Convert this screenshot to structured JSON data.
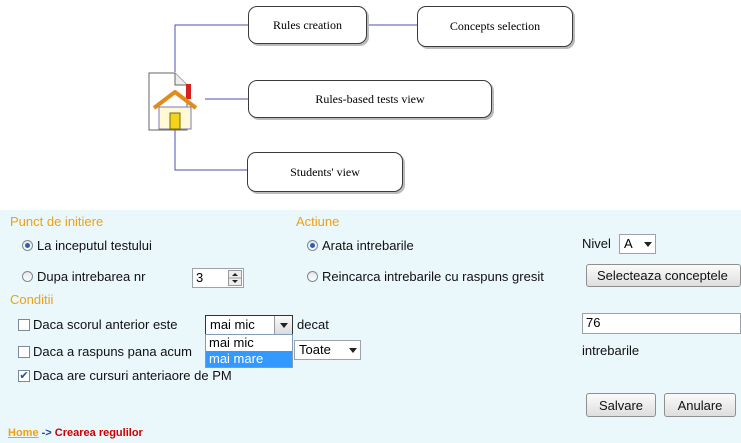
{
  "diagram": {
    "nodes": {
      "rules_creation": "Rules creation",
      "concepts_selection": "Concepts selection",
      "rules_tests_view": "Rules-based tests view",
      "students_view": "Students' view"
    },
    "icons": {
      "home": "home-document-icon"
    }
  },
  "form": {
    "punct_title": "Punct de initiere",
    "actiune_title": "Actiune",
    "conditii_title": "Conditii",
    "start_label": "La inceputul testului",
    "after_label": "Dupa intrebarea nr",
    "after_value": "3",
    "show_label": "Arata intrebarile",
    "reload_label": "Reincarca intrebarile cu raspuns gresit",
    "nivel_label": "Nivel",
    "nivel_value": "A",
    "select_concepts": "Selecteaza conceptele",
    "cond1_label": "Daca scorul anterior este",
    "cond1_select": "mai mic",
    "cond1_options": [
      "mai mic",
      "mai mare"
    ],
    "cond1_after": "decat",
    "cond1_value": "76",
    "cond2_label": "Daca a raspuns pana acum",
    "cond2_select": "Toate",
    "cond2_after": "intrebarile",
    "cond3_label": "Daca are cursuri anteriaore de PM",
    "save": "Salvare",
    "cancel": "Anulare"
  },
  "breadcrumb": {
    "home": "Home",
    "sep": "->",
    "current": "Crearea regulilor"
  },
  "colors": {
    "accent": "#f1a10c",
    "breadcrumb": "#cc0000",
    "bg": "#eaf7fb"
  }
}
